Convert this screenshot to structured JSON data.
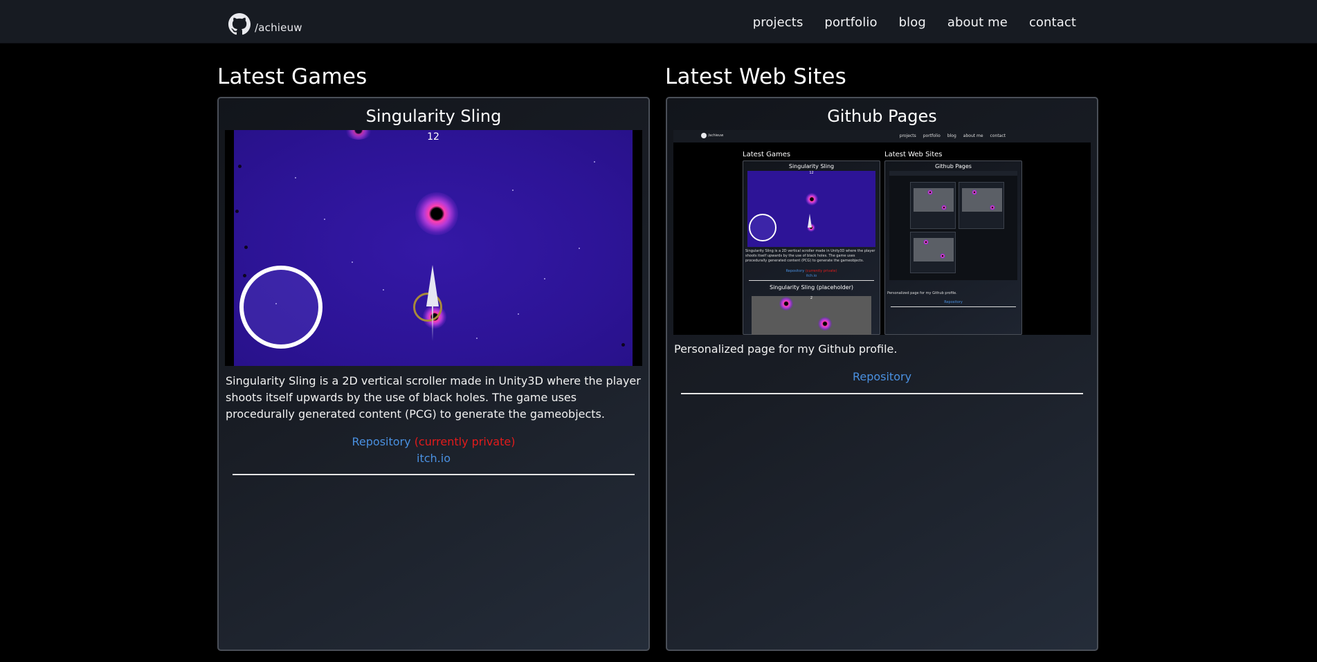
{
  "navbar": {
    "brand": {
      "icon": "github-icon",
      "label": "/achieuw"
    },
    "links": [
      "projects",
      "portfolio",
      "blog",
      "about me",
      "contact"
    ]
  },
  "sections": {
    "games_title": "Latest Games",
    "web_title": "Latest Web Sites"
  },
  "games_card": {
    "title": "Singularity Sling",
    "preview": {
      "score": "12"
    },
    "description": "Singularity Sling is a 2D vertical scroller made in Unity3D where the player shoots itself upwards by the use of black holes. The game uses procedurally generated content (PCG) to generate the gameobjects.",
    "repository_label": "Repository",
    "private_label": "(currently private)",
    "itch_label": "itch.io"
  },
  "web_card": {
    "title": "Github Pages",
    "description": "Personalized page for my Github profile.",
    "repository_label": "Repository",
    "preview": {
      "brand": "/achieuw",
      "links": [
        "projects",
        "portfolio",
        "blog",
        "about me",
        "contact"
      ],
      "games_title": "Latest Games",
      "web_title": "Latest Web Sites",
      "game_card_title": "Singularity Sling",
      "game_score": "12",
      "game_desc": "Singularity Sling is a 2D vertical scroller made in Unity3D where the player shoots itself upwards by the use of black holes. The game uses procedurally generated content (PCG) to generate the gameobjects.",
      "repo": "Repository",
      "private": "(currently private)",
      "itch": "itch.io",
      "second_game_title": "Singularity Sling (placeholder)",
      "second_game_score": "2",
      "web_card_title": "Github Pages",
      "web_desc": "Personalized page for my Github profile.",
      "web_repo": "Repository"
    }
  },
  "colors": {
    "link": "#4a90e0",
    "private": "#e31b1b",
    "navbar": "#171b22",
    "game_background": "#2d1497"
  }
}
